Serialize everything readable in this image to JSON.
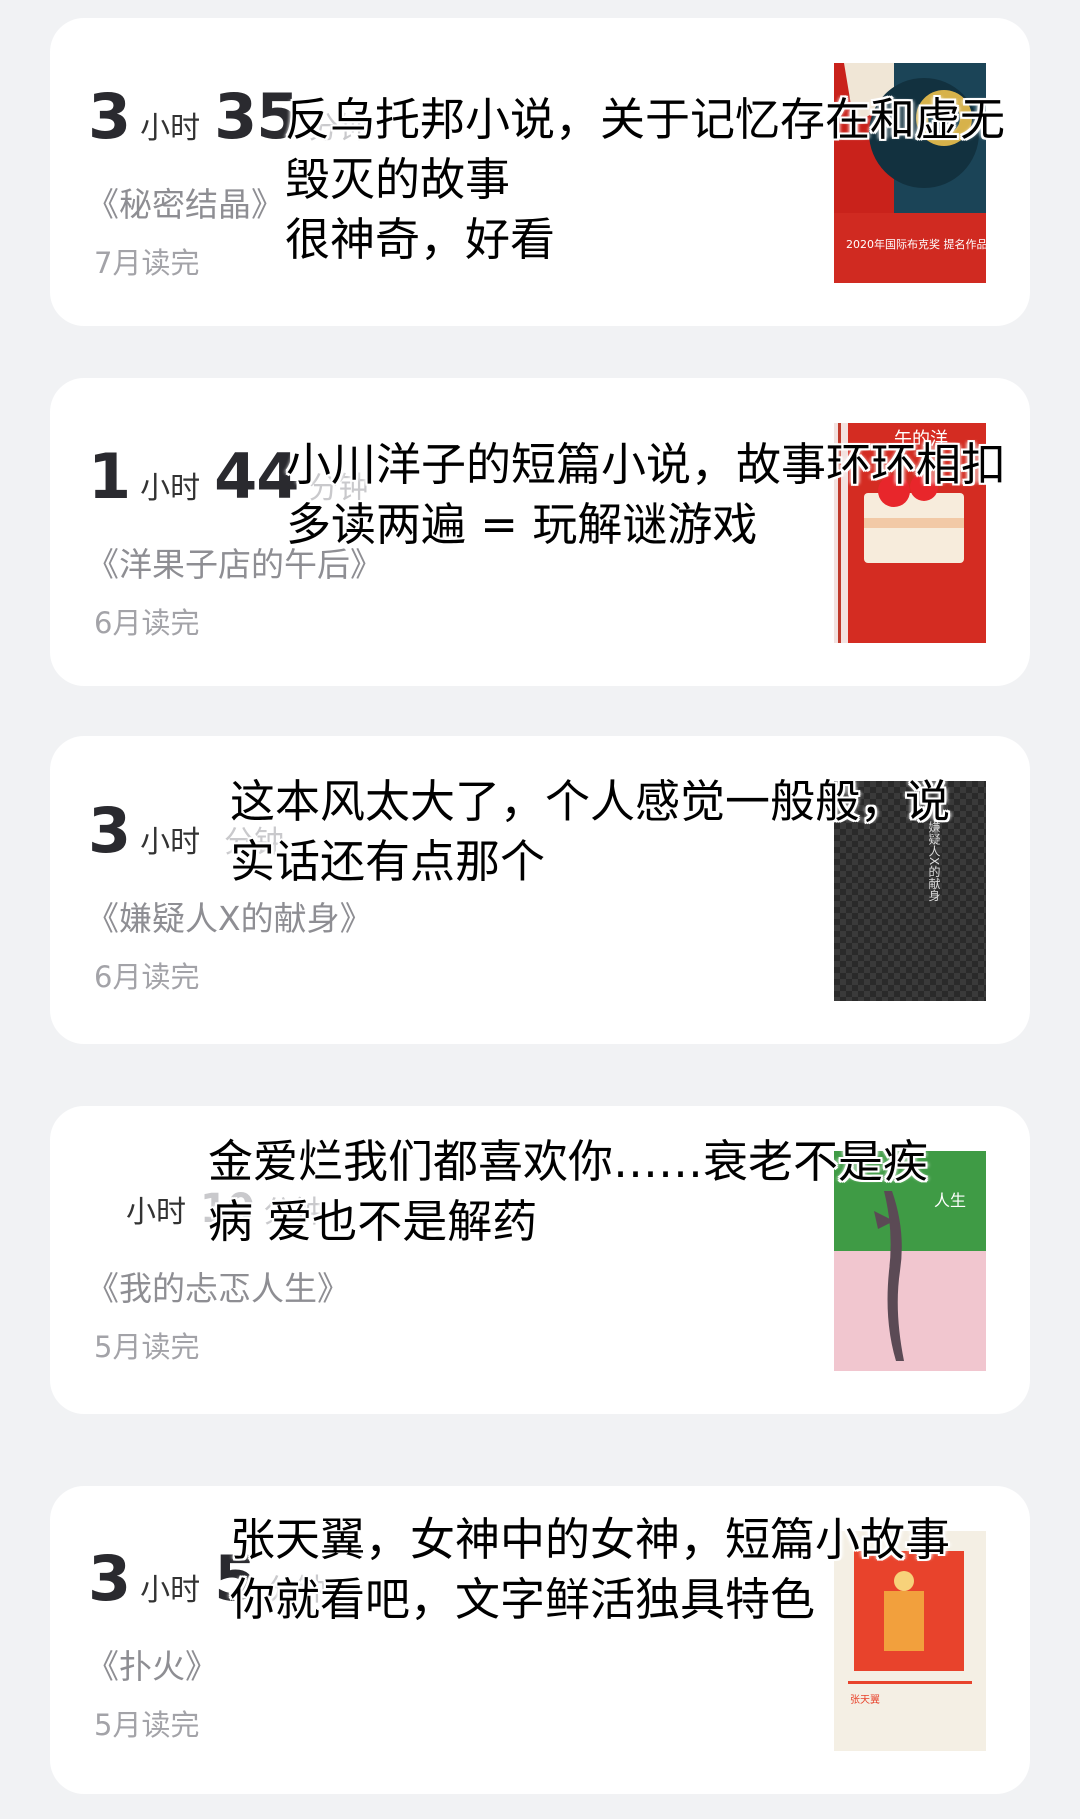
{
  "cards": [
    {
      "dur_hours": "3",
      "dur_hours_unit": "小时",
      "dur_minutes": "35",
      "dur_minutes_unit": "分钟",
      "title": "《秘密结晶》",
      "date": "7月读完",
      "cover_color": "#1c4a5e",
      "cover_text": "2020年国际布克奖 提名作品",
      "overlay": [
        "反乌托邦小说，关于记忆存在和虚无",
        "毁灭的故事",
        "很神奇，好看"
      ]
    },
    {
      "dur_hours": "1",
      "dur_hours_unit": "小时",
      "dur_minutes": "44",
      "dur_minutes_unit": "分钟",
      "title": "《洋果子店的午后》",
      "date": "6月读完",
      "cover_color": "#cf2b22",
      "cover_text": "午的洋",
      "overlay": [
        "小川洋子的短篇小说，故事环环相扣",
        "多读两遍 = 玩解谜游戏"
      ]
    },
    {
      "dur_hours": "3",
      "dur_hours_unit": "小时",
      "dur_minutes": "",
      "dur_minutes_unit": "分钟",
      "title": "《嫌疑人X的献身》",
      "date": "6月读完",
      "cover_color": "#2b2b2b",
      "cover_text": "嫌疑人X的献身",
      "overlay": [
        "这本风太大了，个人感觉一般般，说",
        "实话还有点那个"
      ]
    },
    {
      "dur_hours": "",
      "dur_hours_unit": "小时",
      "dur_minutes": "10",
      "dur_minutes_unit": "分钟",
      "title": "《我的忐忑人生》",
      "date": "5月读完",
      "cover_color": "#3f9b45",
      "cover_text": "人生",
      "overlay": [
        "金爱烂我们都喜欢你……衰老不是疾",
        "病 爱也不是解药"
      ]
    },
    {
      "dur_hours": "3",
      "dur_hours_unit": "小时",
      "dur_minutes": "5",
      "dur_minutes_unit": "分钟",
      "title": "《扑火》",
      "date": "5月读完",
      "cover_color": "#f4efe4",
      "cover_text": "张天翼",
      "overlay": [
        "张天翼，女神中的女神，短篇小故事",
        "你就看吧，文字鲜活独具特色"
      ]
    }
  ]
}
